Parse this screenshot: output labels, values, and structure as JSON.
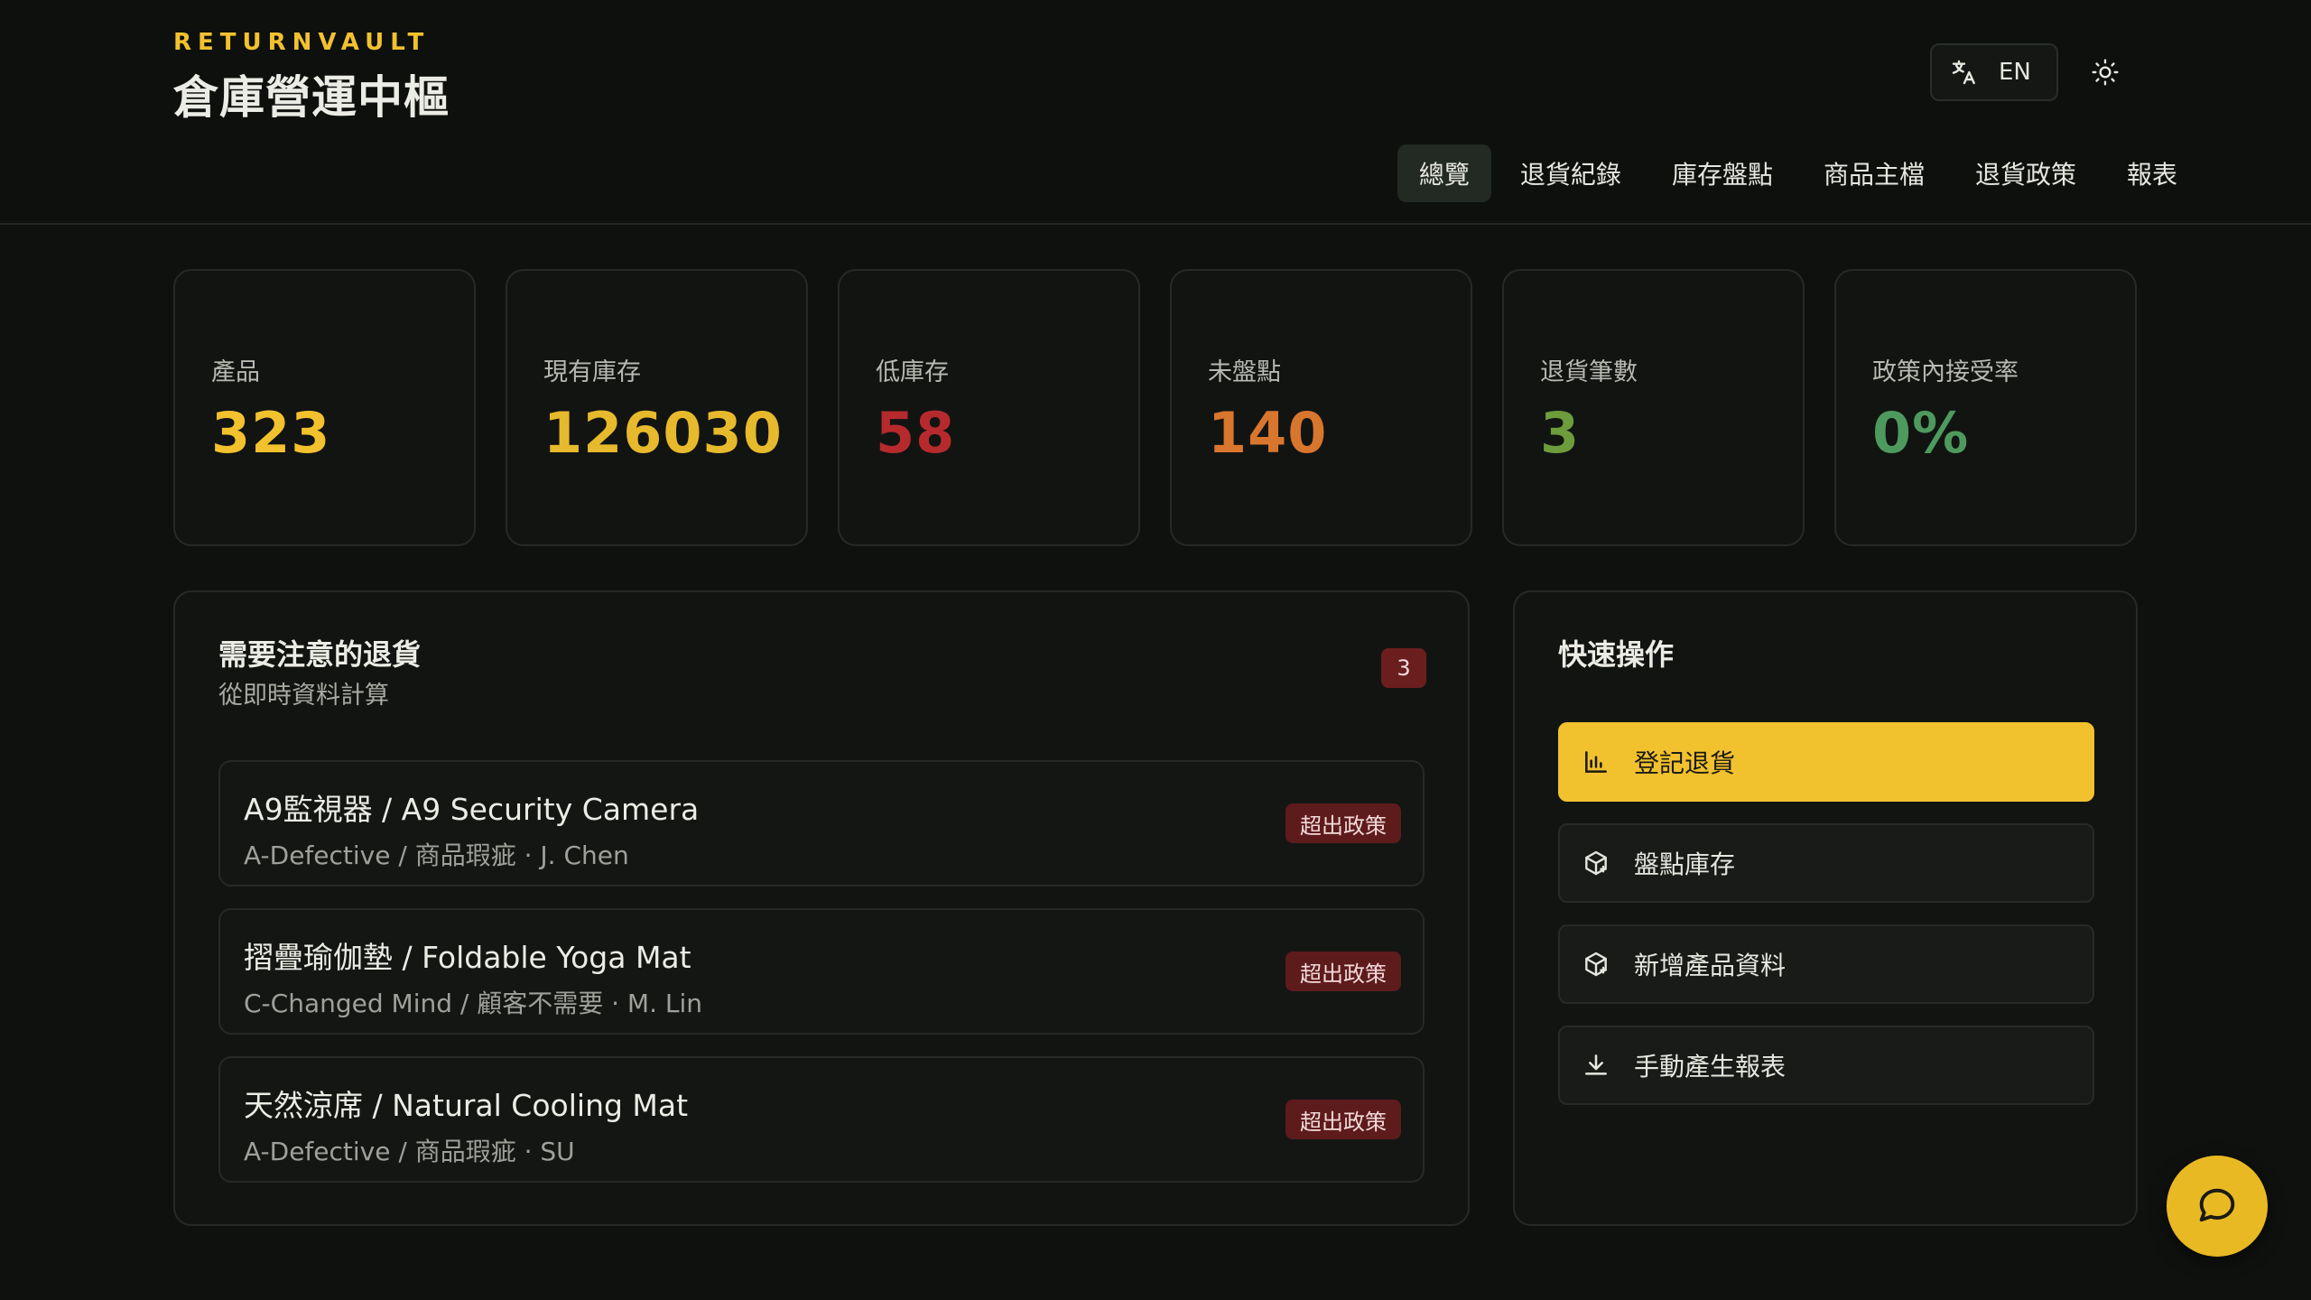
{
  "header": {
    "brand_kicker": "RETURNVAULT",
    "brand_title": "倉庫營運中樞",
    "lang_label": "EN",
    "lang_icon": "translate-icon",
    "theme_icon": "sun-icon"
  },
  "nav": [
    {
      "label": "總覽",
      "active": true
    },
    {
      "label": "退貨紀錄",
      "active": false
    },
    {
      "label": "庫存盤點",
      "active": false
    },
    {
      "label": "商品主檔",
      "active": false
    },
    {
      "label": "退貨政策",
      "active": false
    },
    {
      "label": "報表",
      "active": false
    }
  ],
  "stats": [
    {
      "label": "產品",
      "value": "323",
      "color": "#f2c12e"
    },
    {
      "label": "現有庫存",
      "value": "126030",
      "color": "#e7b92c"
    },
    {
      "label": "低庫存",
      "value": "58",
      "color": "#b62a2e"
    },
    {
      "label": "未盤點",
      "value": "140",
      "color": "#d9762d"
    },
    {
      "label": "退貨筆數",
      "value": "3",
      "color": "#6d9c3c"
    },
    {
      "label": "政策內接受率",
      "value": "0%",
      "color": "#4e9a5e"
    }
  ],
  "attention": {
    "title": "需要注意的退貨",
    "subtitle": "從即時資料計算",
    "count": "3",
    "items": [
      {
        "title": "A9監視器 / A9 Security Camera",
        "meta": "A-Defective / 商品瑕疵 · J. Chen",
        "badge": "超出政策"
      },
      {
        "title": "摺疊瑜伽墊 / Foldable Yoga Mat",
        "meta": "C-Changed Mind / 顧客不需要 · M. Lin",
        "badge": "超出政策"
      },
      {
        "title": "天然涼席 / Natural Cooling Mat",
        "meta": "A-Defective / 商品瑕疵 · SU",
        "badge": "超出政策"
      }
    ]
  },
  "quick_actions": {
    "title": "快速操作",
    "items": [
      {
        "label": "登記退貨",
        "icon": "bar-chart-icon"
      },
      {
        "label": "盤點庫存",
        "icon": "package-icon"
      },
      {
        "label": "新增產品資料",
        "icon": "package-icon"
      },
      {
        "label": "手動產生報表",
        "icon": "download-icon"
      }
    ]
  },
  "fab": {
    "icon": "chat-bubble-icon"
  },
  "colors": {
    "accent": "#f2c12e",
    "background": "#0f110f",
    "danger_badge": "#5e1b1c"
  }
}
